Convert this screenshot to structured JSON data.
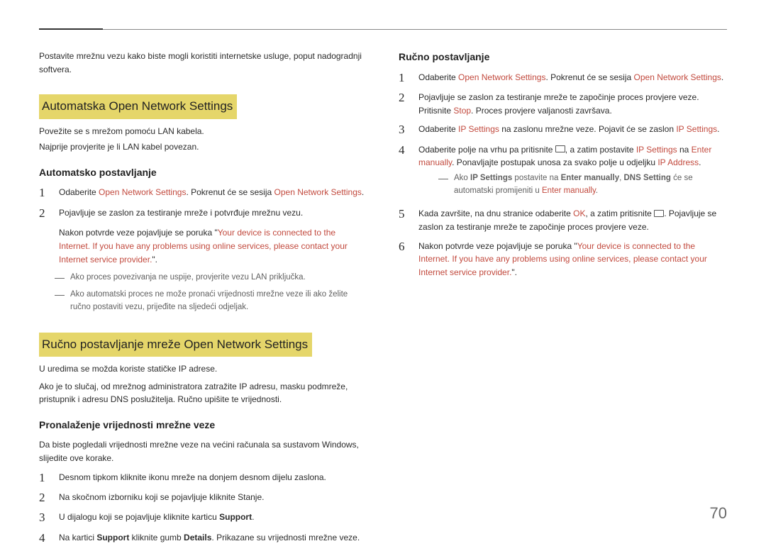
{
  "pageNumber": "70",
  "left": {
    "intro": "Postavite mrežnu vezu kako biste mogli koristiti internetske usluge, poput nadogradnji softvera.",
    "h_auto": "Automatska Open Network Settings",
    "auto_p1": "Povežite se s mrežom pomoću LAN kabela.",
    "auto_p2": "Najprije provjerite je li LAN kabel povezan.",
    "h_autoset": "Automatsko postavljanje",
    "auto_s1_a": "Odaberite ",
    "auto_s1_red1": "Open Network Settings",
    "auto_s1_b": ". Pokrenut će se sesija ",
    "auto_s1_red2": "Open Network Settings",
    "auto_s1_c": ".",
    "auto_s2": "Pojavljuje se zaslon za testiranje mreže i potvrđuje mrežnu vezu.",
    "auto_s2_note_a": "Nakon potvrde veze pojavljuje se poruka \"",
    "auto_s2_note_red": "Your device is connected to the Internet. If you have any problems using online services, please contact your Internet service provider.",
    "auto_s2_note_b": "\".",
    "dash1": "Ako proces povezivanja ne uspije, provjerite vezu LAN priključka.",
    "dash2": "Ako automatski proces ne može pronaći vrijednosti mrežne veze ili ako želite ručno postaviti vezu, prijeđite na sljedeći odjeljak.",
    "h_manual": "Ručno postavljanje mreže Open Network Settings",
    "man_p1": "U uredima se možda koriste statičke IP adrese.",
    "man_p2": "Ako je to slučaj, od mrežnog administratora zatražite IP adresu, masku podmreže, pristupnik i adresu DNS poslužitelja. Ručno upišite te vrijednosti.",
    "h_find": "Pronalaženje vrijednosti mrežne veze",
    "find_p": "Da biste pogledali vrijednosti mrežne veze na većini računala sa sustavom Windows, slijedite ove korake.",
    "find_s1": "Desnom tipkom kliknite ikonu mreže na donjem desnom dijelu zaslona.",
    "find_s2": "Na skočnom izborniku koji se pojavljuje kliknite Stanje.",
    "find_s3_a": "U dijalogu koji se pojavljuje kliknite karticu ",
    "find_s3_b": "Support",
    "find_s3_c": ".",
    "find_s4_a": "Na kartici ",
    "find_s4_b": "Support",
    "find_s4_c": " kliknite gumb ",
    "find_s4_d": "Details",
    "find_s4_e": ". Prikazane su vrijednosti mrežne veze."
  },
  "right": {
    "h_rucno": "Ručno postavljanje",
    "s1_a": "Odaberite ",
    "s1_red1": "Open Network Settings",
    "s1_b": ". Pokrenut će se sesija ",
    "s1_red2": "Open Network Settings",
    "s1_c": ".",
    "s2_a": "Pojavljuje se zaslon za testiranje mreže te započinje proces provjere veze. Pritisnite ",
    "s2_red": "Stop",
    "s2_b": ". Proces provjere valjanosti završava.",
    "s3_a": "Odaberite ",
    "s3_red1": "IP Settings",
    "s3_b": " na zaslonu mrežne veze. Pojavit će se zaslon ",
    "s3_red2": "IP Settings",
    "s3_c": ".",
    "s4_a": "Odaberite polje na vrhu pa pritisnite ",
    "s4_b": ", a zatim postavite ",
    "s4_red1": "IP Settings",
    "s4_c": " na ",
    "s4_red2": "Enter manually",
    "s4_d": ". Ponavljajte postupak unosa za svako polje u odjeljku ",
    "s4_red3": "IP Address",
    "s4_e": ".",
    "dash_a": "Ako ",
    "dash_b1": "IP Settings",
    "dash_c": " postavite na ",
    "dash_b2": "Enter manually",
    "dash_d": ", ",
    "dash_b3": "DNS Setting",
    "dash_e": " će se automatski promijeniti u ",
    "dash_red": "Enter manually",
    "dash_f": ".",
    "s5_a": "Kada završite, na dnu stranice odaberite ",
    "s5_red": "OK",
    "s5_b": ", a zatim pritisnite ",
    "s5_c": ". Pojavljuje se zaslon za testiranje mreže te započinje proces provjere veze.",
    "s6_a": "Nakon potvrde veze pojavljuje se poruka \"",
    "s6_red": "Your device is connected to the Internet. If you have any problems using online services, please contact your Internet service provider.",
    "s6_b": "\"."
  }
}
